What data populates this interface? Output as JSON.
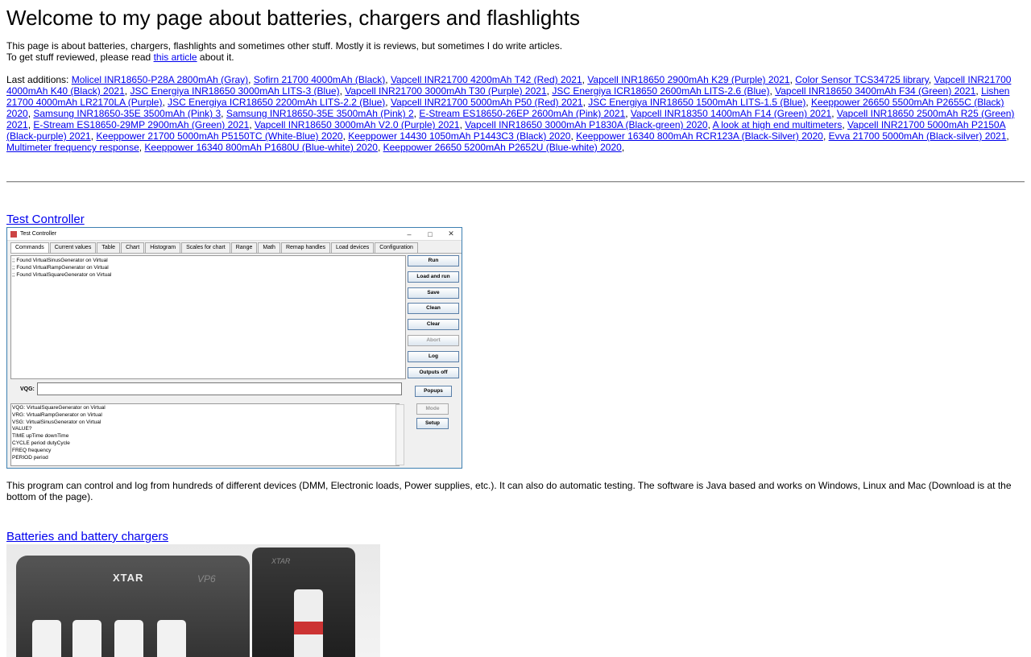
{
  "page": {
    "title": "Welcome to my page about batteries, chargers and flashlights",
    "intro_line1": "This page is about batteries, chargers, flashlights and sometimes other stuff. Mostly it is reviews, but sometimes I do write articles.",
    "intro_line2_before": "To get stuff reviewed, please read ",
    "intro_line2_link": "this article",
    "intro_line2_after": " about it.",
    "additions_label": "Last additions: "
  },
  "additions": [
    "Molicel INR18650-P28A 2800mAh (Gray)",
    "Sofirn 21700 4000mAh (Black)",
    "Vapcell INR21700 4200mAh T42 (Red) 2021",
    "Vapcell INR18650 2900mAh K29 (Purple) 2021",
    "Color Sensor TCS34725 library",
    "Vapcell INR21700 4000mAh K40 (Black) 2021",
    "JSC Energiya INR18650 3000mAh LITS-3 (Blue)",
    "Vapcell INR21700 3000mAh T30 (Purple) 2021",
    "JSC Energiya ICR18650 2600mAh LITS-2.6 (Blue)",
    "Vapcell INR18650 3400mAh F34 (Green) 2021",
    "Lishen 21700 4000mAh LR2170LA (Purple)",
    "JSC Energiya ICR18650 2200mAh LITS-2.2 (Blue)",
    "Vapcell INR21700 5000mAh P50 (Red) 2021",
    "JSC Energiya INR18650 1500mAh LITS-1.5 (Blue)",
    "Keeppower 26650 5500mAh P2655C (Black) 2020",
    "Samsung INR18650-35E 3500mAh (Pink) 3",
    "Samsung INR18650-35E 3500mAh (Pink) 2",
    "E-Stream ES18650-26EP 2600mAh (Pink) 2021",
    "Vapcell INR18350 1400mAh F14 (Green) 2021",
    "Vapcell INR18650 2500mAh R25 (Green) 2021",
    "E-Stream ES18650-29MP 2900mAh (Green) 2021",
    "Vapcell INR18650 3000mAh V2.0 (Purple) 2021",
    "Vapcell INR18650 3000mAh P1830A (Black-green) 2020",
    "A look at high end multimeters",
    "Vapcell INR21700 5000mAh P2150A (Black-purple) 2021",
    "Keeppower 21700 5000mAh P5150TC (White-Blue) 2020",
    "Keeppower 14430 1050mAh P1443C3 (Black) 2020",
    "Keeppower 16340 800mAh RCR123A (Black-Silver) 2020",
    "Evva 21700 5000mAh (Black-silver) 2021",
    "Multimeter frequency response",
    "Keeppower 16340 800mAh P1680U (Blue-white) 2020",
    "Keeppower 26650 5200mAh P2652U (Blue-white) 2020"
  ],
  "test_controller": {
    "link": "Test Controller",
    "window_title": "Test Controller",
    "tabs": [
      "Commands",
      "Current values",
      "Table",
      "Chart",
      "Histogram",
      "Scales for chart",
      "Range",
      "Math",
      "Remap handles",
      "Load devices",
      "Configuration"
    ],
    "log_lines": [
      ";; Found VirtualSinusGenerator on Virtual",
      ";; Found VirtualRampGenerator on Virtual",
      ";; Found VirtualSquareGenerator on Virtual"
    ],
    "side_buttons": [
      "Run",
      "Load and run",
      "Save",
      "Clean",
      "Clear",
      "Abort",
      "Log",
      "Outputs off"
    ],
    "vqg_label": "VQG:",
    "popups": "Popups",
    "cmd_lines": [
      "VQG: VirtualSquareGenerator on Virtual",
      "VRG: VirtualRampGenerator on Virtual",
      "VSG: VirtualSinusGenerator on Virtual",
      "VALUE?",
      "TIME upTime downTime",
      "CYCLE period dutyCycle",
      "FREQ frequency",
      "PERIOD period"
    ],
    "mode": "Mode",
    "setup": "Setup",
    "description": "This program can control and log from hundreds of different devices (DMM, Electronic loads, Power supplies, etc.). It can also do automatic testing. The software is Java based and works on Windows, Linux and Mac (Download is at the bottom of the page)."
  },
  "batteries": {
    "link": "Batteries and battery chargers",
    "photo_brand": "XTAR",
    "photo_model": "VP6",
    "photo_brand2": "XTAR"
  }
}
